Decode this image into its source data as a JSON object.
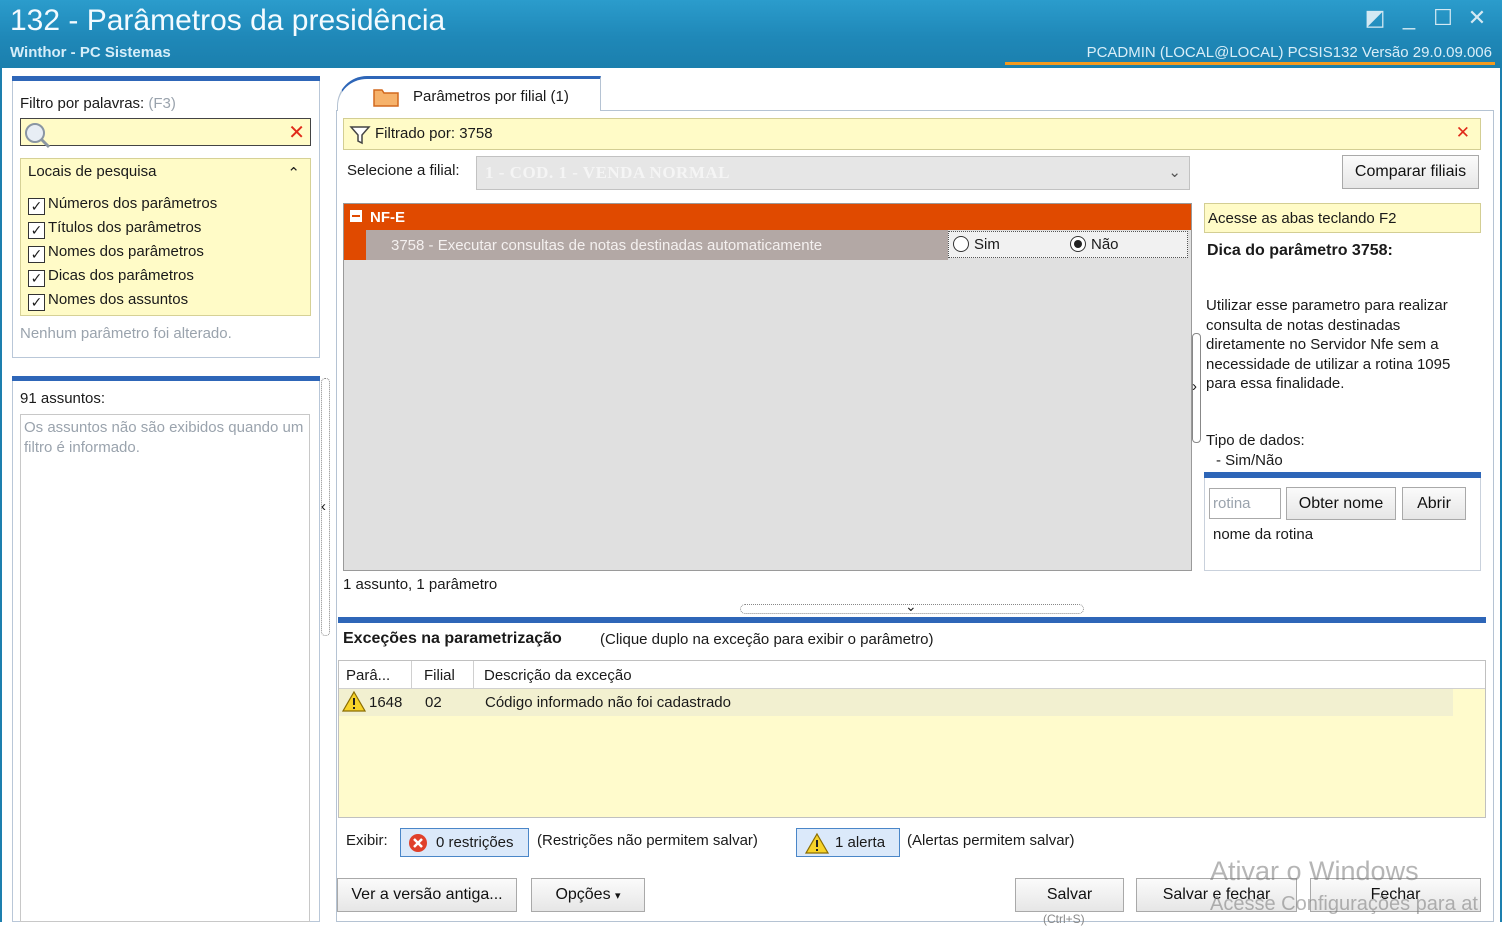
{
  "window": {
    "title": "132 - Parâmetros da presidência",
    "subtitle": "Winthor - PC Sistemas",
    "info": "PCADMIN (LOCAL@LOCAL)   PCSIS132  Versão  29.0.09.006"
  },
  "left": {
    "filter_label": "Filtro por palavras:",
    "filter_hint": "(F3)",
    "search_value": "",
    "locais_title": "Locais de pesquisa",
    "locais": [
      {
        "label": "Números dos parâmetros",
        "checked": true
      },
      {
        "label": "Títulos dos parâmetros",
        "checked": true
      },
      {
        "label": "Nomes dos parâmetros",
        "checked": true
      },
      {
        "label": "Dicas dos parâmetros",
        "checked": true
      },
      {
        "label": "Nomes dos assuntos",
        "checked": true
      }
    ],
    "status": "Nenhum parâmetro foi alterado.",
    "assuntos_title": "91 assuntos:",
    "assuntos_msg": "Os assuntos não são exibidos quando um filtro é informado."
  },
  "main": {
    "tab_label": "Parâmetros por filial  (1)",
    "filter_bar": "Filtrado por: 3758",
    "filial_label": "Selecione a filial:",
    "filial_value": "1 - COD. 1 - VENDA NORMAL",
    "compare_button": "Comparar filiais",
    "group": "NF-E",
    "param_text": "3758 - Executar consultas de notas destinadas automaticamente",
    "radio_sim": "Sim",
    "radio_nao": "Não",
    "radio_selected": "nao",
    "summary": "1 assunto, 1 parâmetro"
  },
  "tip": {
    "access_hint": "Acesse as abas teclando F2",
    "title": "Dica do parâmetro 3758:",
    "body": "Utilizar esse parametro para realizar consulta de notas destinadas diretamente no Servidor Nfe sem a necessidade de utilizar a rotina 1095 para essa finalidade.",
    "type_label": "Tipo de dados:",
    "type_value": "- Sim/Não",
    "rotina_placeholder": "rotina",
    "obter_button": "Obter nome",
    "abrir_button": "Abrir",
    "rotina_name": "nome da rotina"
  },
  "exceptions": {
    "title": "Exceções na parametrização",
    "hint": "(Clique duplo na exceção para exibir o parâmetro)",
    "columns": [
      "Parâ...",
      "Filial",
      "Descrição da exceção"
    ],
    "rows": [
      {
        "param": "1648",
        "filial": "02",
        "desc": "Código informado não foi cadastrado"
      }
    ],
    "exibir_label": "Exibir:",
    "restricoes_button": "0 restrições",
    "restricoes_note": "(Restrições não permitem salvar)",
    "alerta_button": "1 alerta",
    "alerta_note": "(Alertas permitem salvar)"
  },
  "footer": {
    "versao_button": "Ver a versão antiga...",
    "opcoes_button": "Opções",
    "salvar_button": "Salvar",
    "salvar_fechar_button": "Salvar e fechar",
    "fechar_button": "Fechar",
    "shortcut": "(Ctrl+S)"
  },
  "watermark": {
    "line1": "Ativar o Windows",
    "line2": "Acesse Configurações para at"
  },
  "colors": {
    "titlebar": "#1f88b8",
    "accent_blue": "#2e66b8",
    "group_orange": "#e04a00",
    "yellow_bg": "#fffbc7"
  }
}
